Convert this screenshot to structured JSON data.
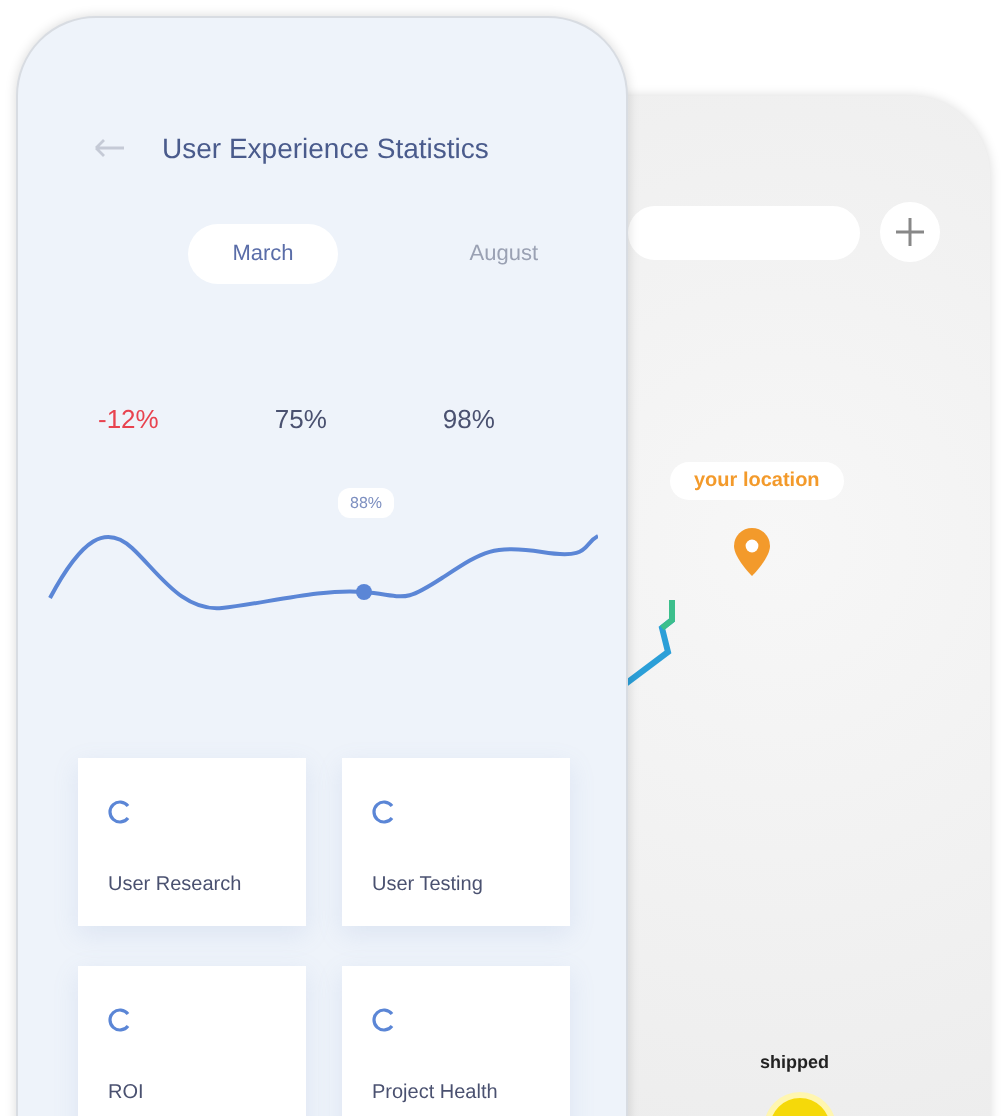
{
  "stats_screen": {
    "title": "User Experience Statistics",
    "tabs": [
      {
        "label": "March",
        "selected": true
      },
      {
        "label": "August",
        "selected": false
      }
    ],
    "stats": [
      {
        "value": "-12%",
        "color": "#e8434f"
      },
      {
        "value": "75%",
        "color": "#4a5170"
      },
      {
        "value": "98%",
        "color": "#4a5170"
      }
    ],
    "chart_tooltip": "88%",
    "cards": [
      {
        "title": "User Research"
      },
      {
        "title": "User Testing"
      },
      {
        "title": "ROI"
      },
      {
        "title": "Project Health"
      }
    ]
  },
  "map_screen": {
    "location_label": "your location",
    "status": "shipped"
  }
}
